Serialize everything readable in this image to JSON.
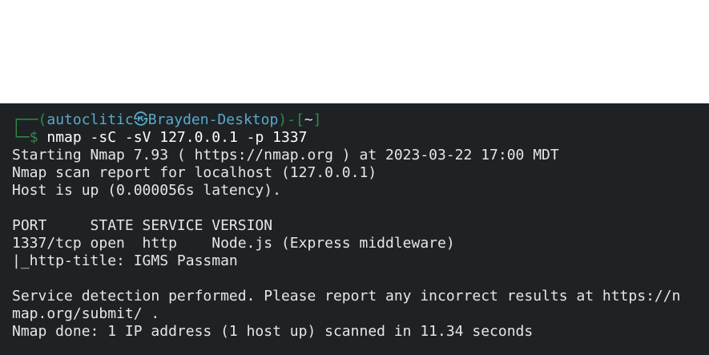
{
  "prompt": {
    "frame_top": "┌──(",
    "user": "autoclitic",
    "at_symbol": "㉿",
    "host": "Brayden-Desktop",
    "close_paren": ")-[",
    "dir": "~",
    "close_bracket": "]",
    "frame_bottom": "└─",
    "dollar": "$",
    "command": " nmap -sC -sV 127.0.0.1 -p 1337"
  },
  "output": {
    "line1": "Starting Nmap 7.93 ( https://nmap.org ) at 2023-03-22 17:00 MDT",
    "line2": "Nmap scan report for localhost (127.0.0.1)",
    "line3": "Host is up (0.000056s latency).",
    "header": "PORT     STATE SERVICE VERSION",
    "port_row": "1337/tcp open  http    Node.js (Express middleware)",
    "http_title": "|_http-title: IGMS Passman",
    "service_detection_1": "Service detection performed. Please report any incorrect results at https://n",
    "service_detection_2": "map.org/submit/ .",
    "done": "Nmap done: 1 IP address (1 host up) scanned in 11.34 seconds"
  }
}
